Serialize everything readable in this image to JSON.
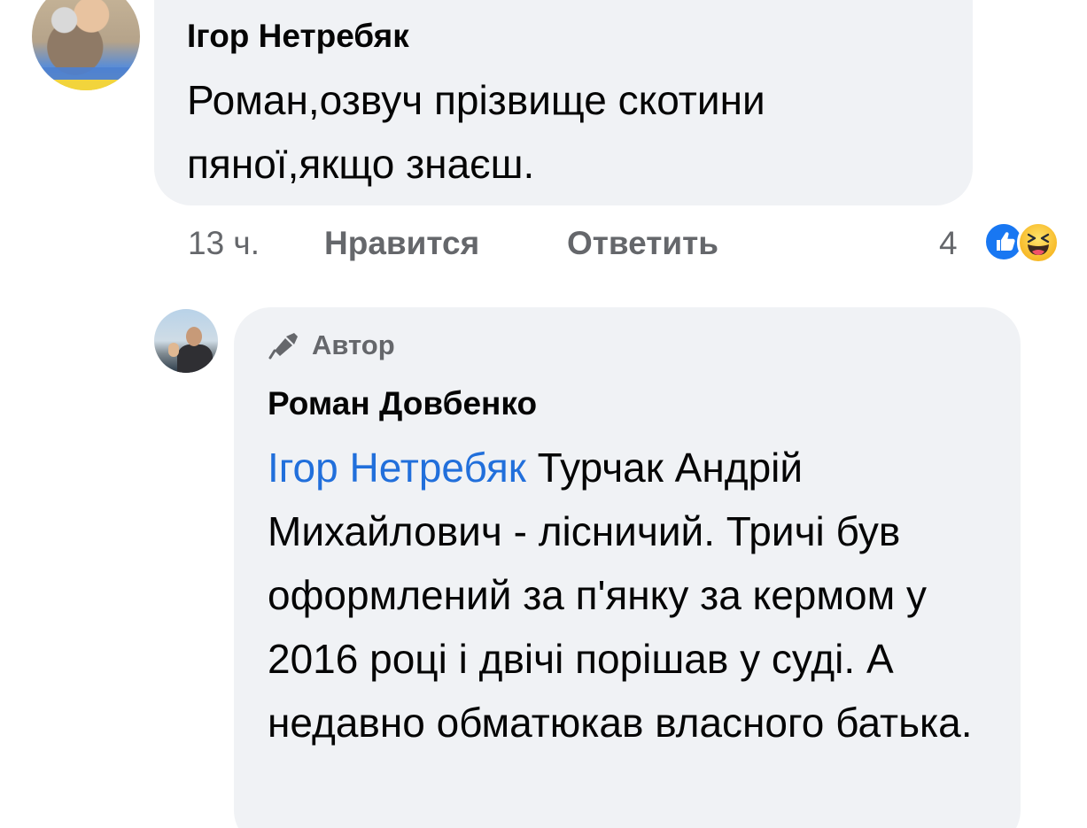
{
  "comment1": {
    "author": "Ігор Нетребяк",
    "text": "Роман,озвуч прізвище скотини пяної,якщо знаєш.",
    "time": "13 ч.",
    "like_label": "Нравится",
    "reply_label": "Ответить",
    "reaction_count": "4",
    "reactions": [
      "like-icon",
      "haha-icon"
    ]
  },
  "comment2": {
    "badge": "Автор",
    "author": "Роман Довбенко",
    "mention": "Ігор Нетребяк",
    "text": " Турчак Андрій Михайлович - лісничий. Тричі був оформлений за п'янку за кермом у 2016 році і двічі порішав у суді. А недавно обматюкав власного батька."
  },
  "colors": {
    "bubble": "#f0f2f5",
    "mention": "#216fdb",
    "meta": "#65676b",
    "like": "#1877f2"
  }
}
